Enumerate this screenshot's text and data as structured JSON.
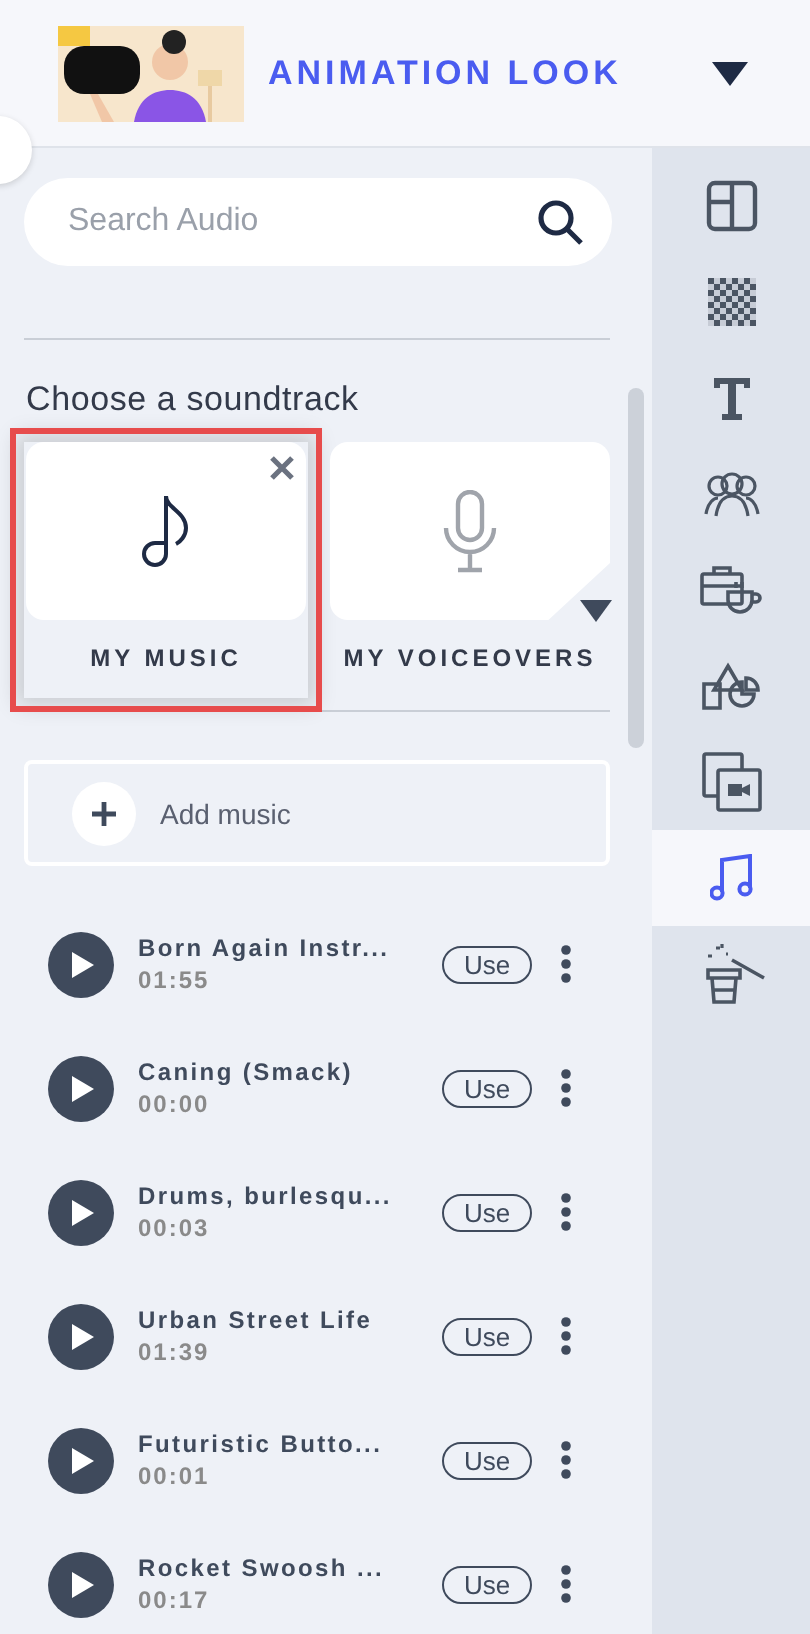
{
  "header": {
    "title": "ANIMATION LOOK"
  },
  "search": {
    "placeholder": "Search Audio"
  },
  "section_title": "Choose a soundtrack",
  "tabs": [
    {
      "label": "MY MUSIC",
      "selected": true,
      "kind": "music"
    },
    {
      "label": "MY VOICEOVERS",
      "selected": false,
      "kind": "voice"
    }
  ],
  "add_button": "Add music",
  "tracks": [
    {
      "title": "Born Again Instr...",
      "duration": "01:55",
      "action": "Use"
    },
    {
      "title": "Caning (Smack)",
      "duration": "00:00",
      "action": "Use"
    },
    {
      "title": "Drums, burlesqu...",
      "duration": "00:03",
      "action": "Use"
    },
    {
      "title": "Urban Street Life",
      "duration": "01:39",
      "action": "Use"
    },
    {
      "title": "Futuristic Butto...",
      "duration": "00:01",
      "action": "Use"
    },
    {
      "title": "Rocket Swoosh ...",
      "duration": "00:17",
      "action": "Use"
    }
  ],
  "sidebar": {
    "items": [
      {
        "kind": "layout",
        "selected": false
      },
      {
        "kind": "background",
        "selected": false
      },
      {
        "kind": "text",
        "selected": false
      },
      {
        "kind": "characters",
        "selected": false
      },
      {
        "kind": "props",
        "selected": false
      },
      {
        "kind": "shapes",
        "selected": false
      },
      {
        "kind": "media",
        "selected": false
      },
      {
        "kind": "music",
        "selected": true
      },
      {
        "kind": "effects",
        "selected": false
      }
    ]
  }
}
